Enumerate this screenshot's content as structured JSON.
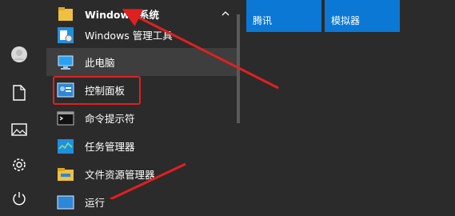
{
  "group": {
    "title": "Windows 系统",
    "collapse_icon": "chevron-up-icon"
  },
  "items": [
    {
      "label": "Windows 管理工具",
      "icon": "admin-tools-icon"
    },
    {
      "label": "此电脑",
      "icon": "this-pc-icon"
    },
    {
      "label": "控制面板",
      "icon": "control-panel-icon"
    },
    {
      "label": "命令提示符",
      "icon": "cmd-icon"
    },
    {
      "label": "任务管理器",
      "icon": "task-manager-icon"
    },
    {
      "label": "文件资源管理器",
      "icon": "file-explorer-icon"
    },
    {
      "label": "运行",
      "icon": "run-icon"
    }
  ],
  "tiles": [
    {
      "label": "腾讯"
    },
    {
      "label": "模拟器"
    }
  ],
  "rail": [
    "user-avatar-icon",
    "documents-icon",
    "pictures-icon",
    "settings-icon",
    "power-icon"
  ],
  "colors": {
    "accent": "#0a78d4",
    "annotation": "#e02020",
    "background": "#2b2b2b"
  }
}
